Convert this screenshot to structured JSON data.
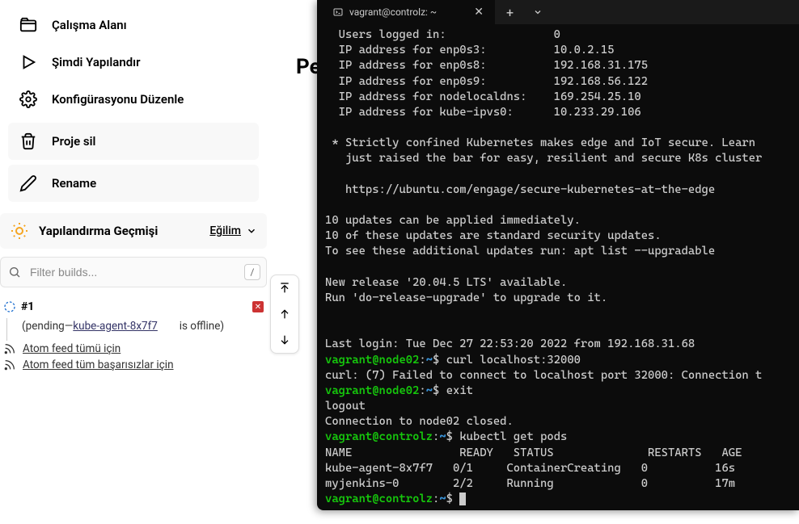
{
  "sidebar": {
    "workspace": "Çalışma Alanı",
    "build_now": "Şimdi Yapılandır",
    "configure": "Konfigürasyonu Düzenle",
    "delete_project": "Proje sil",
    "rename": "Rename"
  },
  "history": {
    "title": "Yapılandırma Geçmişi",
    "trend": "Eğilim"
  },
  "filter": {
    "placeholder": "Filter builds...",
    "shortcut": "/"
  },
  "build": {
    "hash": "#1",
    "pending_prefix": "(pending—",
    "agent": "kube-agent-8x7f7",
    "offline_suffix": "is offline)"
  },
  "feeds": {
    "all": "Atom feed tümü için",
    "failures": "Atom feed tüm başarısızlar için"
  },
  "page": {
    "partial_title": "Per"
  },
  "terminal": {
    "tab_title": "vagrant@controlz: ~",
    "output": [
      "  Users logged in:                0",
      "  IP address for enp0s3:          10.0.2.15",
      "  IP address for enp0s8:          192.168.31.175",
      "  IP address for enp0s9:          192.168.56.122",
      "  IP address for nodelocaldns:    169.254.25.10",
      "  IP address for kube-ipvs0:      10.233.29.106",
      "",
      " * Strictly confined Kubernetes makes edge and IoT secure. Learn ",
      "   just raised the bar for easy, resilient and secure K8s cluster",
      "",
      "   https://ubuntu.com/engage/secure-kubernetes-at-the-edge",
      "",
      "10 updates can be applied immediately.",
      "10 of these updates are standard security updates.",
      "To see these additional updates run: apt list --upgradable",
      "",
      "New release '20.04.5 LTS' available.",
      "Run 'do-release-upgrade' to upgrade to it.",
      "",
      "",
      "Last login: Tue Dec 27 22:53:20 2022 from 192.168.31.68"
    ],
    "lines": {
      "p1_user": "vagrant@node02",
      "p1_sep": ":",
      "p1_path": "~",
      "p1_dollar": "$ ",
      "p1_cmd": "curl localhost:32000",
      "p1_out": "curl: (7) Failed to connect to localhost port 32000: Connection t",
      "p2_cmd": "exit",
      "p2_out1": "logout",
      "p2_out2": "Connection to node02 closed.",
      "p3_user": "vagrant@controlz",
      "p3_cmd": "kubectl get pods",
      "pods_hdr": "NAME                READY   STATUS              RESTARTS   AGE",
      "pods_r1": "kube-agent-8x7f7   0/1     ContainerCreating   0          16s",
      "pods_r2": "myjenkins-0        2/2     Running             0          17m"
    }
  }
}
